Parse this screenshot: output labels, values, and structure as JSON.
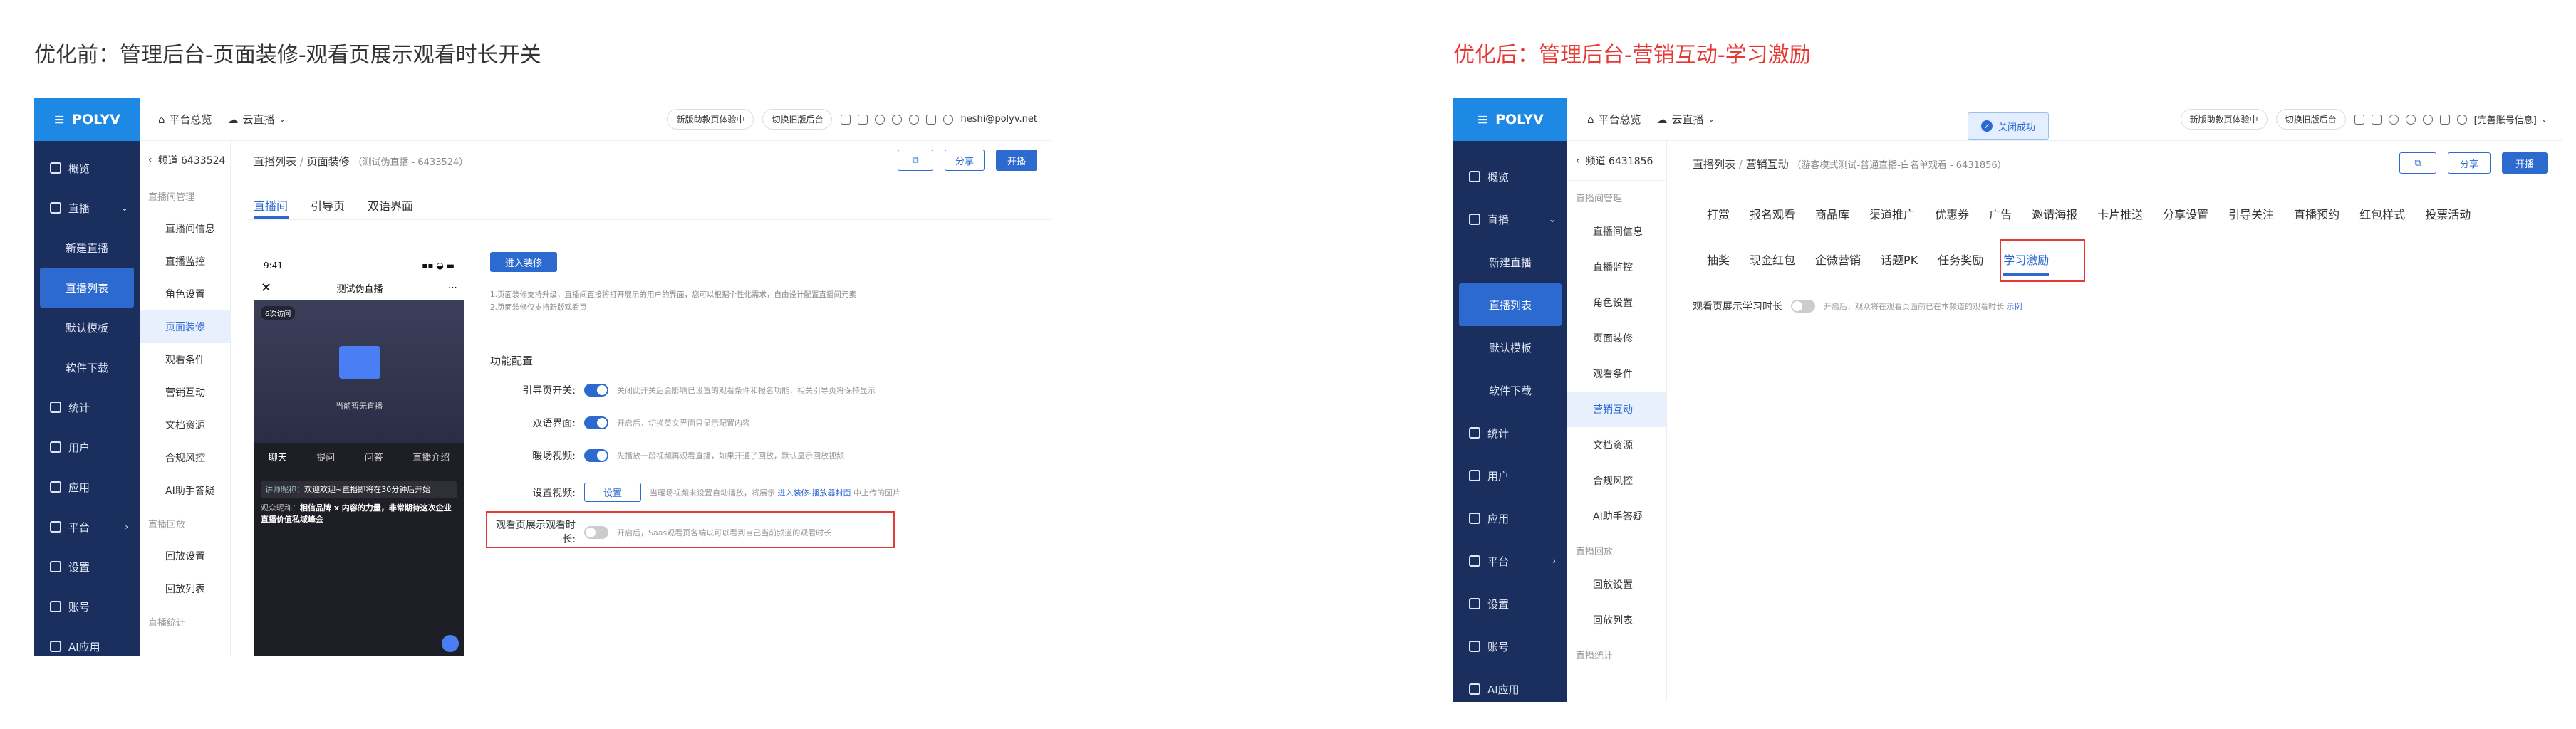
{
  "captions": {
    "before": "优化前：管理后台-页面装修-观看页展示观看时长开关",
    "after": "优化后：管理后台-营销互动-学习激励"
  },
  "colors": {
    "sidebar": "#1b2f5e",
    "brand": "#1e88e5",
    "primary": "#2d6ad0",
    "highlight": "#e53935"
  },
  "brand": "POLYV",
  "left": {
    "topbar": {
      "overview": "平台总览",
      "live": "云直播",
      "pill1": "新版助教页体验中",
      "pill2": "切换旧版后台",
      "email": "heshi@polyv.net"
    },
    "sidebar": [
      {
        "label": "概览",
        "icon": "overview-icon"
      },
      {
        "label": "直播",
        "icon": "live-icon"
      },
      {
        "label": "新建直播",
        "sub": true
      },
      {
        "label": "直播列表",
        "sub": true,
        "active": true
      },
      {
        "label": "默认模板",
        "sub": true
      },
      {
        "label": "软件下载",
        "sub": true
      },
      {
        "label": "统计",
        "icon": "stats-icon"
      },
      {
        "label": "用户",
        "icon": "user-icon"
      },
      {
        "label": "应用",
        "icon": "apps-icon"
      },
      {
        "label": "平台",
        "icon": "platform-icon"
      },
      {
        "label": "设置",
        "icon": "settings-icon"
      },
      {
        "label": "账号",
        "icon": "account-icon"
      },
      {
        "label": "AI应用",
        "icon": "ai-icon"
      }
    ],
    "channel": "频道 6433524",
    "sub_menu": {
      "group1": "直播间管理",
      "items": [
        "直播间信息",
        "直播监控",
        "角色设置",
        "页面装修",
        "观看条件",
        "营销互动",
        "文档资源",
        "合规风控",
        "AI助手答疑"
      ],
      "group2": "直播回放",
      "items2": [
        "回放设置",
        "回放列表"
      ],
      "group3": "直播统计"
    },
    "crumbs": {
      "list": "直播列表",
      "page": "页面装修",
      "note": "（测试伪直播 - 6433524）"
    },
    "buttons": {
      "copy": "⧉",
      "share": "分享",
      "start": "开播"
    },
    "tabs": [
      "直播间",
      "引导页",
      "双语界面"
    ],
    "phone": {
      "time": "9:41",
      "title": "测试伪直播",
      "state": "当前暂无直播",
      "badge": "6次访问",
      "tabs": [
        "聊天",
        "提问",
        "问答",
        "直播介绍"
      ],
      "msg1_name": "讲师昵称：",
      "msg1": "欢迎欢迎~直播即将在30分钟后开始",
      "msg2_name": "观众昵称：",
      "msg2": "相信品牌 x 内容的力量，非常期待这次企业直播价值私域峰会"
    },
    "enter_btn": "进入装修",
    "notes": [
      "1.页面装修支持升级，直播间直接将打开展示的用户的界面，您可以根据个性化需求，自由设计配置直播间元素",
      "2.页面装修仅支持新版观看页"
    ],
    "section": "功能配置",
    "rows": [
      {
        "label": "引导页开关:",
        "on": true,
        "desc": "关闭此开关后会影响已设置的观看条件和报名功能，相关引导页将保持显示"
      },
      {
        "label": "双语界面:",
        "on": true,
        "desc": "开启后，切换英文界面只显示配置内容"
      },
      {
        "label": "暖场视频:",
        "on": true,
        "desc": "先播放一段视频再观看直播，如果开通了回放，默认显示回放视频"
      },
      {
        "label": "设置视频:",
        "button": "设置",
        "desc": "当暖场视频未设置自动播放，将展示 ",
        "link": "进入装修-播放器封面",
        "desc2": " 中上传的图片"
      },
      {
        "label": "观看页展示观看时长:",
        "on": false,
        "desc": "开启后，Saas观看页各端以可以看到自己当前频道的观看时长"
      }
    ]
  },
  "right": {
    "toast": "关闭成功",
    "topbar": {
      "overview": "平台总览",
      "live": "云直播",
      "pill1": "新版助教页体验中",
      "pill2": "切换旧版后台",
      "account": "[完善账号信息]"
    },
    "sidebar": [
      {
        "label": "概览",
        "icon": "overview-icon"
      },
      {
        "label": "直播",
        "icon": "live-icon"
      },
      {
        "label": "新建直播",
        "sub": true
      },
      {
        "label": "直播列表",
        "sub": true,
        "active": true
      },
      {
        "label": "默认模板",
        "sub": true
      },
      {
        "label": "软件下载",
        "sub": true
      },
      {
        "label": "统计",
        "icon": "stats-icon"
      },
      {
        "label": "用户",
        "icon": "user-icon"
      },
      {
        "label": "应用",
        "icon": "apps-icon"
      },
      {
        "label": "平台",
        "icon": "platform-icon"
      },
      {
        "label": "设置",
        "icon": "settings-icon"
      },
      {
        "label": "账号",
        "icon": "account-icon"
      },
      {
        "label": "AI应用",
        "icon": "ai-icon"
      }
    ],
    "channel": "频道 6431856",
    "sub_menu": {
      "group1": "直播间管理",
      "items": [
        "直播间信息",
        "直播监控",
        "角色设置",
        "页面装修",
        "观看条件",
        "营销互动",
        "文档资源",
        "合规风控",
        "AI助手答疑"
      ],
      "group2": "直播回放",
      "items2": [
        "回放设置",
        "回放列表"
      ],
      "group3": "直播统计"
    },
    "crumbs": {
      "list": "直播列表",
      "page": "营销互动",
      "note": "（游客模式测试-普通直播-白名单观看 - 6431856）"
    },
    "buttons": {
      "copy": "⧉",
      "share": "分享",
      "start": "开播"
    },
    "tabs_row1": [
      "打赏",
      "报名观看",
      "商品库",
      "渠道推广",
      "优惠券",
      "广告",
      "邀请海报",
      "卡片推送",
      "分享设置",
      "引导关注",
      "直播预约",
      "红包样式",
      "投票活动"
    ],
    "tabs_row2": [
      "抽奖",
      "现金红包",
      "企微营销",
      "话题PK",
      "任务奖励",
      "学习激励"
    ],
    "setting": {
      "label": "观看页展示学习时长",
      "on": false,
      "desc": "开启后，观众将在观看页面前已在本频道的观看时长 ",
      "link": "示例"
    }
  }
}
